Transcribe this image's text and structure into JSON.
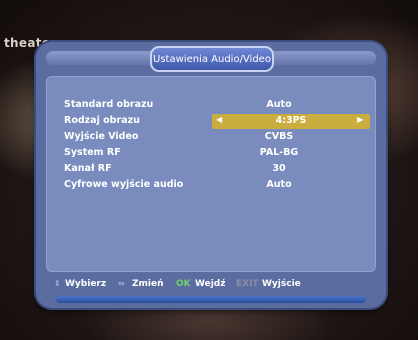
{
  "background": {
    "channel_name": "theater"
  },
  "menu": {
    "title": "Ustawienia Audio/Video",
    "rows": [
      {
        "label": "Standard obrazu",
        "value": "Auto"
      },
      {
        "label": "Rodzaj obrazu",
        "value": "4:3PS"
      },
      {
        "label": "Wyjście Video",
        "value": "CVBS"
      },
      {
        "label": "System RF",
        "value": "PAL-BG"
      },
      {
        "label": "Kanał RF",
        "value": "30"
      },
      {
        "label": "Cyfrowe wyjście audio",
        "value": "Auto"
      }
    ],
    "selected_row": "Rodzaj obrazu"
  },
  "footer": {
    "select_label": "Wybierz",
    "change_label": "Zmień",
    "ok_key": "OK",
    "ok_label": "Wejdź",
    "exit_key": "EXIT",
    "exit_label": "Wyjście"
  },
  "colors": {
    "panel": "#5b6da0",
    "content": "#7a8cbd",
    "highlight": "#c9ae3f",
    "title_tab": "#4f68b8",
    "ok_key": "#6fd46a"
  }
}
